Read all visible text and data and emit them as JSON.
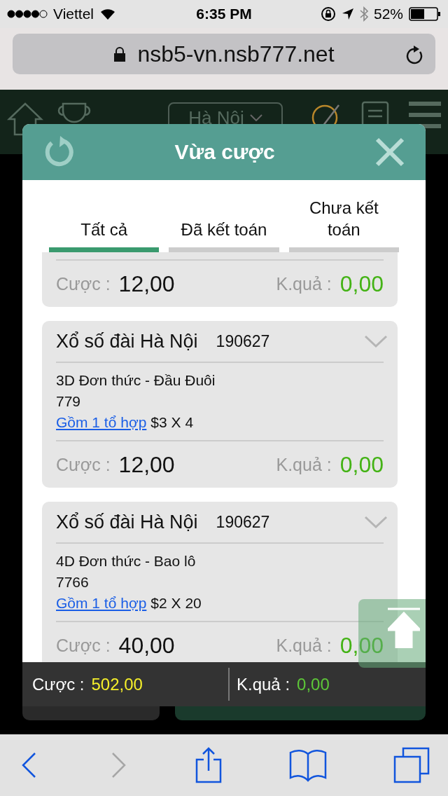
{
  "status_bar": {
    "carrier": "Viettel",
    "time": "6:35 PM",
    "battery": "52%"
  },
  "address_bar": {
    "url": "nsb5-vn.nsb777.net"
  },
  "app_header": {
    "region": "Hà Nội"
  },
  "modal": {
    "title": "Vừa cược",
    "tabs": [
      {
        "label": "Tất cả",
        "selected": true
      },
      {
        "label": "Đã kết toán",
        "selected": false
      },
      {
        "label": "Chưa kết toán",
        "selected": false
      }
    ],
    "bets": [
      {
        "stake_label": "Cược :",
        "stake": "12,00",
        "result_label": "K.quả :",
        "result": "0,00"
      },
      {
        "title": "Xổ số đài Hà Nội",
        "draw": "190627",
        "bet_type": "3D Đơn thức - Đầu Đuôi",
        "numbers": "779",
        "combo_link": "Gồm 1 tổ hợp",
        "combo_detail": "$3 X 4",
        "stake_label": "Cược :",
        "stake": "12,00",
        "result_label": "K.quả :",
        "result": "0,00"
      },
      {
        "title": "Xổ số đài Hà Nội",
        "draw": "190627",
        "bet_type": "4D Đơn thức - Bao lô",
        "numbers": "7766",
        "combo_link": "Gồm 1 tổ hợp",
        "combo_detail": "$2 X 20",
        "stake_label": "Cược :",
        "stake": "40,00",
        "result_label": "K.quả :",
        "result": "0,00"
      }
    ],
    "summary": {
      "stake_label": "Cược :",
      "stake": "502,00",
      "result_label": "K.quả :",
      "result": "0,00"
    }
  },
  "toolbar": [
    {
      "kind": "back",
      "disabled": false
    },
    {
      "kind": "forward",
      "disabled": true
    },
    {
      "kind": "share",
      "disabled": false
    },
    {
      "kind": "bookmarks",
      "disabled": false
    },
    {
      "kind": "tabs",
      "disabled": false
    }
  ]
}
